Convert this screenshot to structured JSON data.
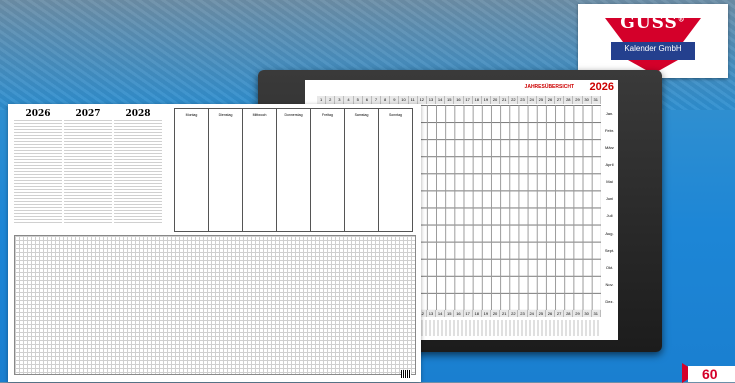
{
  "brand": {
    "name": "GÜSS",
    "mark": "®",
    "subtitle": "Kalender GmbH",
    "accent": "#d4002a",
    "band": "#24408e"
  },
  "year_planner": {
    "title": "JAHRESÜBERSICHT",
    "year": "2026",
    "months": [
      "Jan.",
      "Febr.",
      "März",
      "April",
      "Mai",
      "Juni",
      "Juli",
      "Aug.",
      "Sept.",
      "Okt.",
      "Nov.",
      "Dez."
    ],
    "days": [
      "1",
      "2",
      "3",
      "4",
      "5",
      "6",
      "7",
      "8",
      "9",
      "10",
      "11",
      "12",
      "13",
      "14",
      "15",
      "16",
      "17",
      "18",
      "19",
      "20",
      "21",
      "22",
      "23",
      "24",
      "25",
      "26",
      "27",
      "28",
      "29",
      "30",
      "31"
    ]
  },
  "desk_pad": {
    "years": [
      "2026",
      "2027",
      "2028"
    ],
    "weekdays": [
      "Montag",
      "Dienstag",
      "Mittwoch",
      "Donnerstag",
      "Freitag",
      "Samstag",
      "Sonntag"
    ]
  },
  "badge": {
    "text": "60"
  }
}
